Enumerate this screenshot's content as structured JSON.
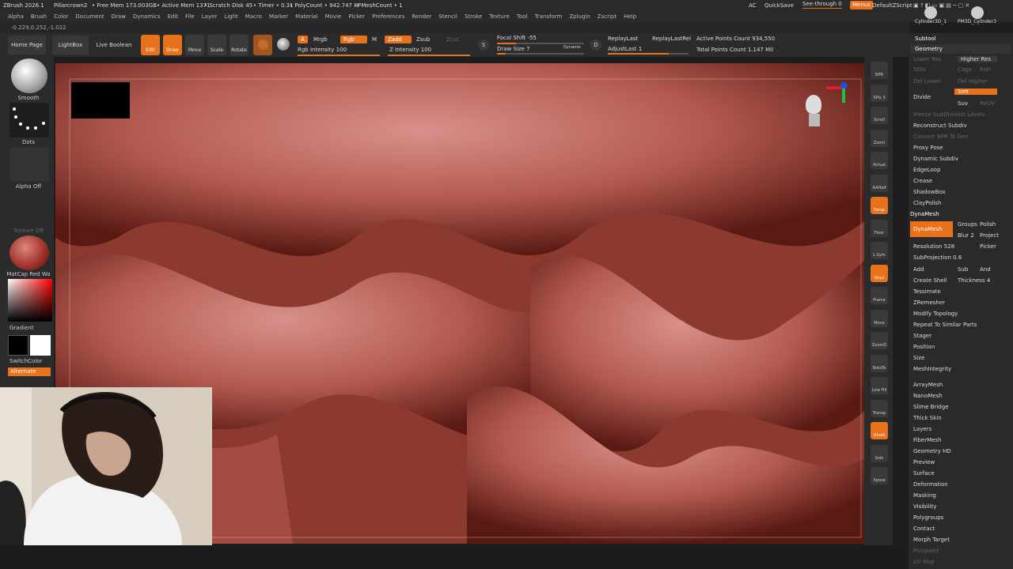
{
  "titlebar": {
    "app": "ZBrush 2026.1",
    "project": "Pillarcrown2",
    "free_mem": "• Free Mem 173.003GB",
    "active_mem": "• Active Mem 1371",
    "scratch": "• Scratch Disk 45",
    "timer": "• Timer • 0.31",
    "polycount": "• PolyCount • 942.747 KP",
    "meshcount": "• MeshCount • 1",
    "ac": "AC",
    "quicksave": "QuickSave",
    "see_through": "See-through  0",
    "menus": "Menus",
    "default_script": "DefaultZScript"
  },
  "menus": [
    "Alpha",
    "Brush",
    "Color",
    "Document",
    "Draw",
    "Dynamics",
    "Edit",
    "File",
    "Layer",
    "Light",
    "Macro",
    "Marker",
    "Material",
    "Movie",
    "Picker",
    "Preferences",
    "Render",
    "Stencil",
    "Stroke",
    "Texture",
    "Tool",
    "Transform",
    "Zplugin",
    "Zscript",
    "Help"
  ],
  "coords": "-0.229,0.252,-1.022",
  "toolbar": {
    "home": "Home Page",
    "lightbox": "LightBox",
    "live_boolean": "Live Boolean",
    "edit": "Edit",
    "draw": "Draw",
    "move": "Move",
    "scale": "Scale",
    "rotate": "Rotate",
    "a_label": "A",
    "mrgb": "Mrgb",
    "rgb": "Rgb",
    "m": "M",
    "zadd": "Zadd",
    "zsub": "Zsub",
    "zcut": "Zcut",
    "rgb_intensity": "Rgb Intensity 100",
    "z_intensity": "Z Intensity 100",
    "focal_shift": "Focal Shift -55",
    "draw_size": "Draw Size 7",
    "dynamic": "Dynamic",
    "replay_last": "ReplayLast",
    "replay_last_rel": "ReplayLastRel",
    "adjust_last": "AdjustLast 1",
    "active_points": "Active Points Count 934,550",
    "total_points": "Total Points Count 1.147 Mil"
  },
  "left_panel": {
    "smooth": "Smooth",
    "dots": "Dots",
    "alpha_off": "Alpha Off",
    "texture_off": "Texture Off",
    "matcap": "MatCap Red Wa",
    "gradient": "Gradient",
    "switch_color": "SwitchColor",
    "alternate": "Alternate"
  },
  "right_shelf": [
    "BPR",
    "SPix 3",
    "Scroll",
    "Zoom",
    "Actual",
    "AAHalf",
    "Persp",
    "Floor",
    "L.Sym",
    "Qxyz",
    "Frame",
    "Move",
    "ZoomD",
    "RotaTe",
    "Line Fill",
    "Transp",
    "Ghost",
    "Solo",
    "Xpose"
  ],
  "right_panel": {
    "tools": [
      "Cylinder3D_1",
      "PM3D_Cylinder3"
    ],
    "subtool": "Subtool",
    "geometry": "Geometry",
    "lower_res": "Lower Res",
    "higher_res": "Higher Res",
    "sdiv": "SDiv",
    "cage": "Cage",
    "rstr": "Rstr",
    "del_lower": "Del Lower",
    "del_higher": "Del Higher",
    "divide": "Divide",
    "smt": "Smt",
    "suv": "Suv",
    "reuv": "ReUV",
    "freeze": "Freeze SubDivision Levels",
    "reconstruct": "Reconstruct Subdiv",
    "convert_bpr": "Convert BPR To Geo",
    "items1": [
      "Proxy Pose",
      "Dynamic Subdiv",
      "EdgeLoop",
      "Crease",
      "ShadowBox",
      "ClayPolish"
    ],
    "dynamesh_hdr": "DynaMesh",
    "dynamesh_btn": "DynaMesh",
    "groups": "Groups",
    "polish": "Polish",
    "blur": "Blur 2",
    "project": "Project",
    "resolution": "Resolution 528",
    "picker": "Picker",
    "subprojection": "SubProjection 0.6",
    "add": "Add",
    "sub": "Sub",
    "and": "And",
    "create_shell": "Create Shell",
    "thickness": "Thickness 4",
    "items2": [
      "Tessimate",
      "ZRemesher",
      "Modify Topology",
      "Repeat To Similar Parts",
      "Stager",
      "Position",
      "Size",
      "MeshIntegrity"
    ],
    "items3": [
      "ArrayMesh",
      "NanoMesh",
      "Slime Bridge",
      "Thick Skin",
      "Layers",
      "FiberMesh",
      "Geometry HD",
      "Preview",
      "Surface",
      "Deformation",
      "Masking",
      "Visibility",
      "Polygroups",
      "Contact",
      "Morph Target",
      "Polypaint",
      "UV Map"
    ]
  },
  "colors": {
    "accent": "#e8711c",
    "panel": "#2b2b2b",
    "sculpt": "#8e3a30"
  }
}
